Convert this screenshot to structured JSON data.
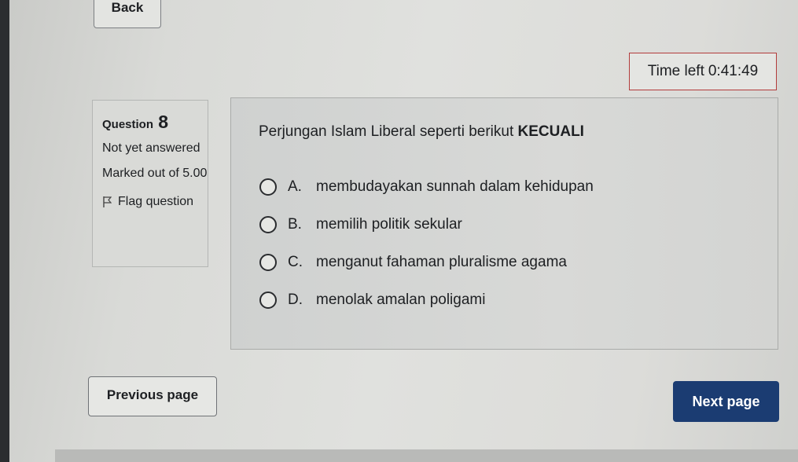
{
  "nav": {
    "back_label": "Back",
    "previous_label": "Previous page",
    "next_label": "Next page"
  },
  "timer": {
    "label": "Time left",
    "value": "0:41:49"
  },
  "question_info": {
    "prefix": "Question",
    "number": "8",
    "state": "Not yet answered",
    "marked": "Marked out of 5.00",
    "flag_label": "Flag question",
    "flag_icon": "flag-icon"
  },
  "question": {
    "text": "Perjungan Islam Liberal seperti berikut",
    "emphasis": "KECUALI",
    "answers": [
      {
        "letter": "A.",
        "text": "membudayakan sunnah dalam kehidupan"
      },
      {
        "letter": "B.",
        "text": "memilih politik sekular"
      },
      {
        "letter": "C.",
        "text": "menganut fahaman pluralisme agama"
      },
      {
        "letter": "D.",
        "text": "menolak amalan poligami"
      }
    ]
  },
  "colors": {
    "next_button": "#1b3c72",
    "timer_border": "#b23b3b"
  }
}
